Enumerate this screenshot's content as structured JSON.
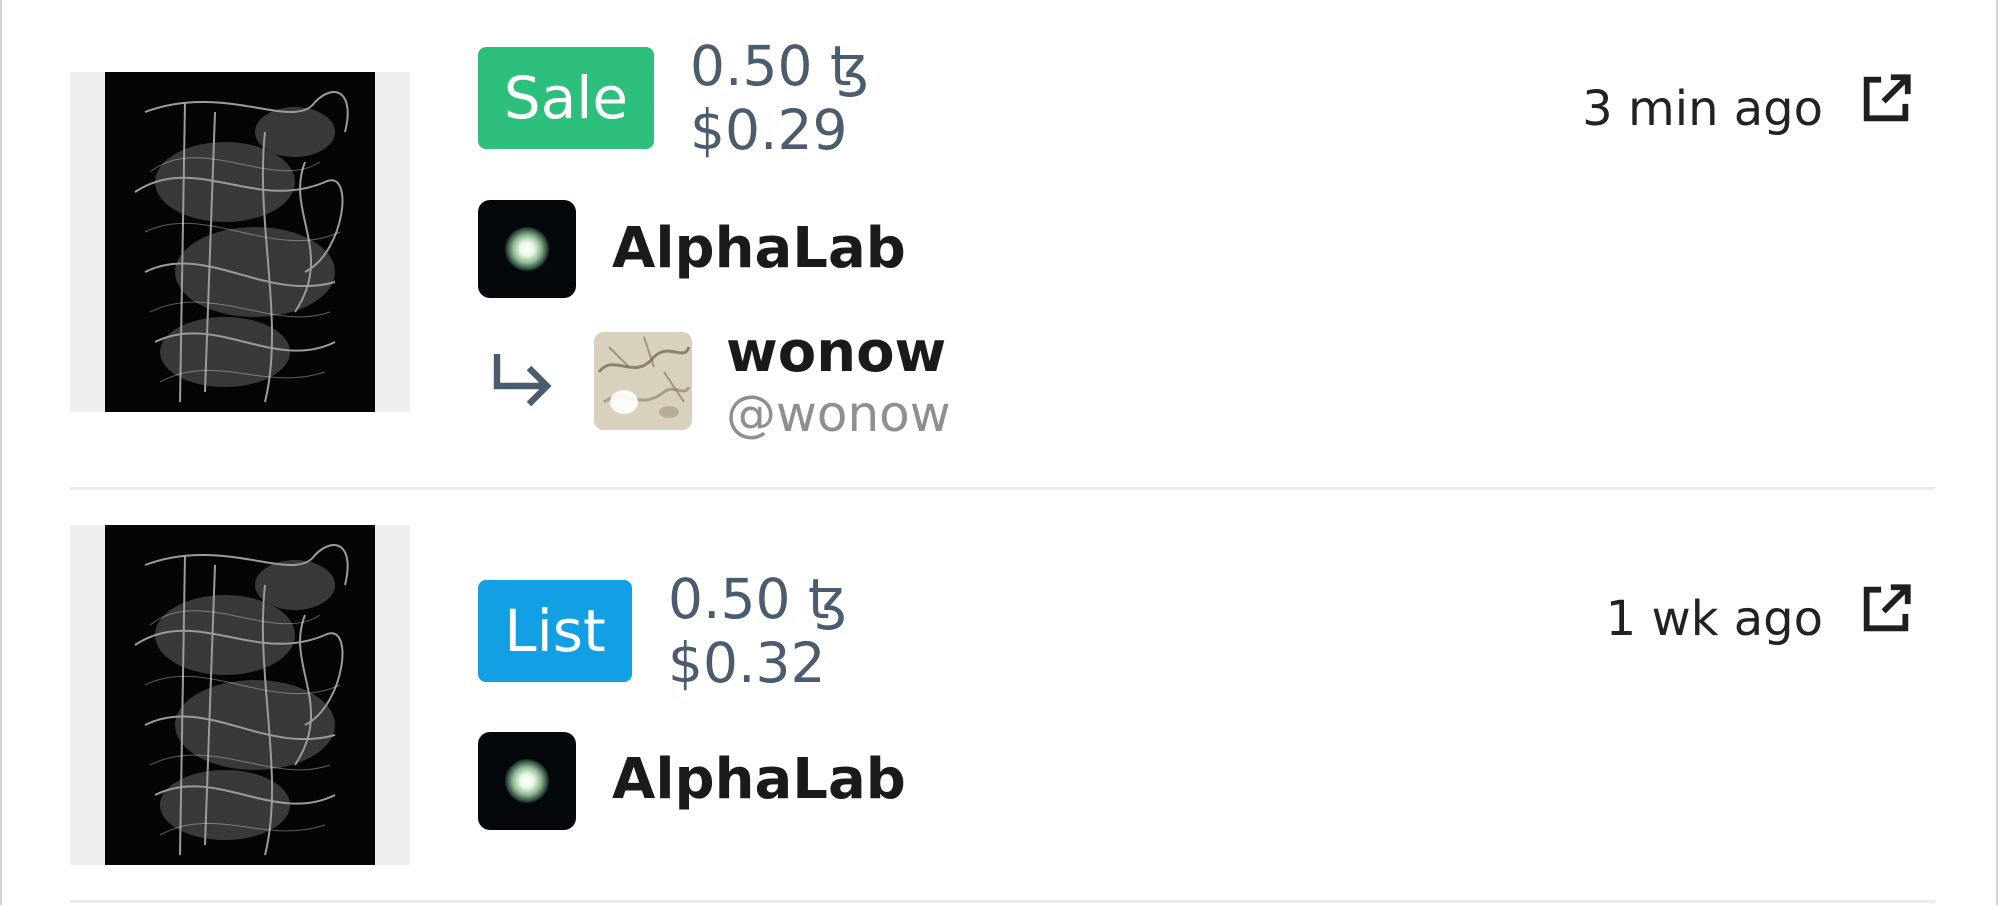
{
  "activity": [
    {
      "type_label": "Sale",
      "type_color": "#2dc07d",
      "price_tez": "0.50 ꜩ",
      "price_usd": "$0.29",
      "time_ago": "3 min ago",
      "artist_name": "AlphaLab",
      "has_recipient": true,
      "recipient_name": "wonow",
      "recipient_handle": "@wonow",
      "icons": {
        "link": "external-link-icon",
        "arrow": "subdirectory-arrow-icon"
      }
    },
    {
      "type_label": "List",
      "type_color": "#129fe3",
      "price_tez": "0.50 ꜩ",
      "price_usd": "$0.32",
      "time_ago": "1 wk ago",
      "artist_name": "AlphaLab",
      "has_recipient": false,
      "icons": {
        "link": "external-link-icon"
      }
    }
  ],
  "colors": {
    "price_text": "#4a5c6e",
    "divider": "#e8ecef",
    "handle_text": "#8f8f8f"
  }
}
